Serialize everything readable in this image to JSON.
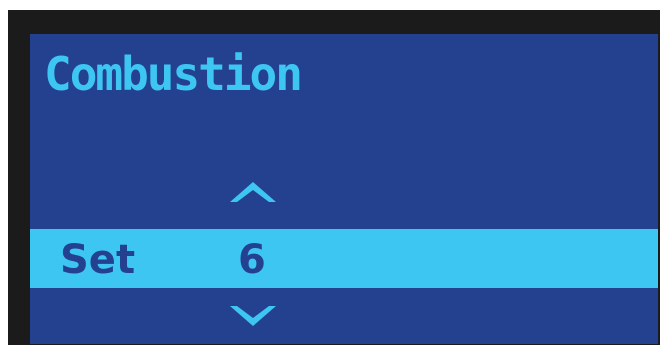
{
  "screen": {
    "title": "Combustion",
    "up_arrow_icon": "arrow-up",
    "down_arrow_icon": "arrow-down",
    "selected_item": {
      "label": "Set",
      "value": "6"
    },
    "colors": {
      "bezel": "#1b1b1b",
      "background": "#24418f",
      "accent": "#3ec6f2",
      "selected_text": "#24418f"
    }
  }
}
